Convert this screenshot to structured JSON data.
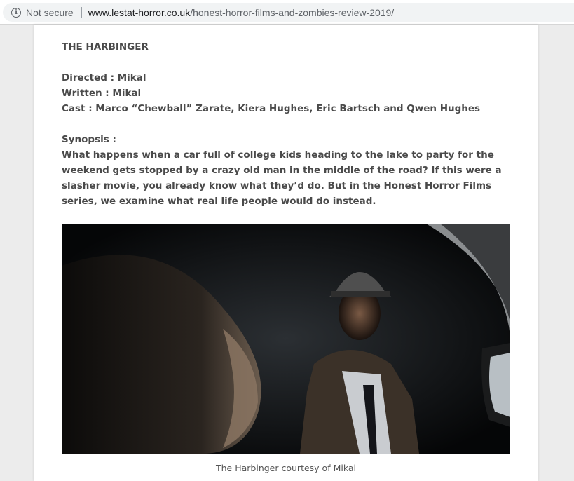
{
  "browser": {
    "security_label": "Not secure",
    "url_domain": "www.lestat-horror.co.uk",
    "url_path": "/honest-horror-films-and-zombies-review-2019/"
  },
  "article": {
    "title": "THE HARBINGER",
    "directed": "Directed : Mikal",
    "written": "Written : Mikal",
    "cast": "Cast : Marco “Chewball” Zarate, Kiera Hughes, Eric Bartsch and Qwen Hughes",
    "synopsis_label": "Synopsis :",
    "synopsis_text": "What happens when a car full of college kids heading to the lake to party for the weekend gets stopped by a crazy old man in the middle of the road? If this were a slasher movie, you already know what they’d do. But in the Honest Horror Films series, we examine what real life people would do instead.",
    "image_caption": "The Harbinger courtesy of Mikal"
  }
}
